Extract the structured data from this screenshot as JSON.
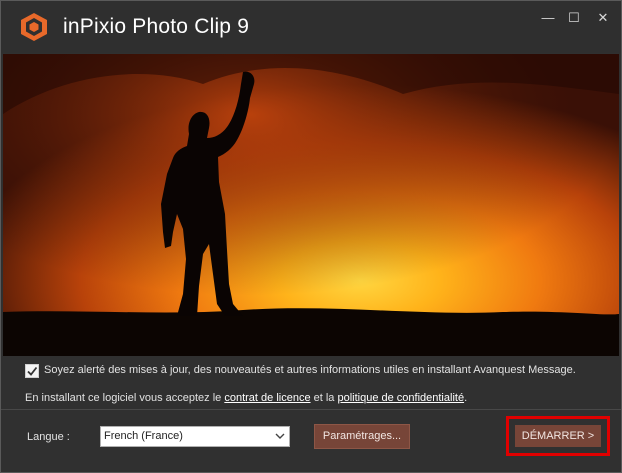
{
  "window": {
    "title": "inPixio Photo Clip 9",
    "controls": {
      "minimize": "—",
      "maximize": "☐",
      "close": "✕"
    }
  },
  "hero": {
    "description_icon": "photo-banner"
  },
  "options": {
    "optin_checked": true,
    "optin_text": "Soyez alerté des mises à jour, des nouveautés et autres informations utiles en installant Avanquest Message.",
    "license_prefix": "En installant ce logiciel vous acceptez le ",
    "license_link": "contrat de licence",
    "license_middle": " et la ",
    "privacy_link": "politique de confidentialité",
    "license_suffix": "."
  },
  "footer": {
    "language_label": "Langue :",
    "language_value": "French (France)",
    "settings_label": "Paramétrages...",
    "start_label": "DÉMARRER  >"
  },
  "colors": {
    "accent": "#774538",
    "highlight": "#e00000",
    "background": "#303030",
    "logo": "#e8692a"
  }
}
